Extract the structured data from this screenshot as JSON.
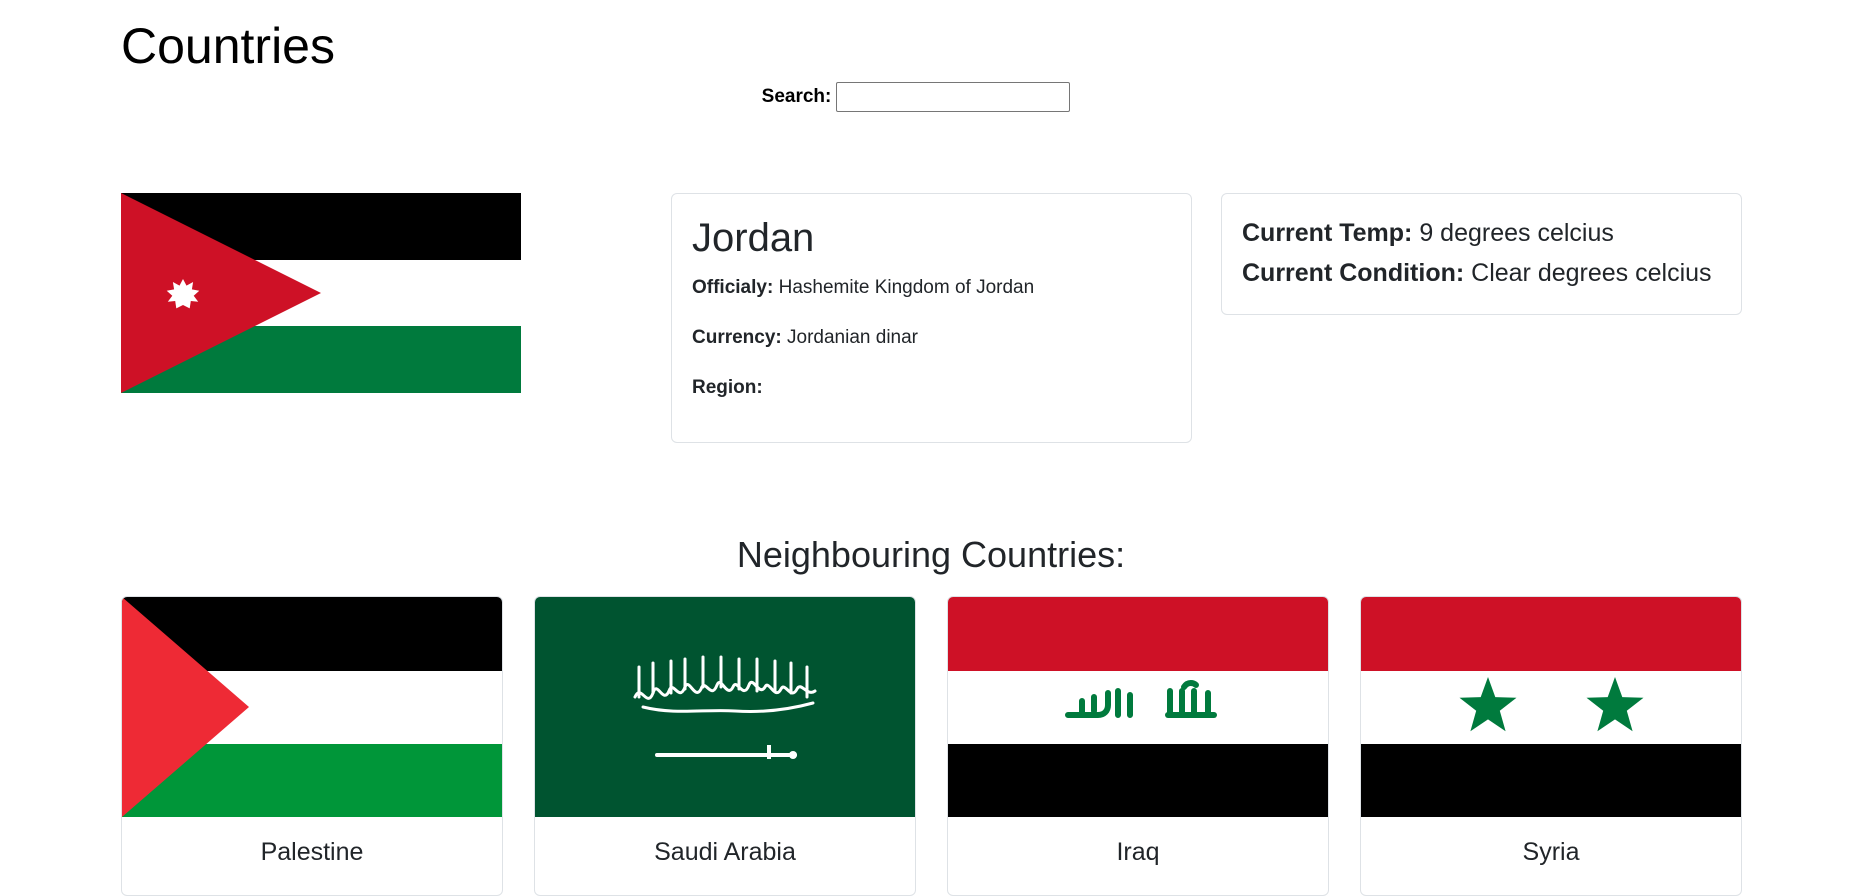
{
  "page": {
    "title": "Countries"
  },
  "search": {
    "label": "Search:",
    "value": "",
    "placeholder": ""
  },
  "country": {
    "name": "Jordan",
    "flag_icon": "jordan-flag",
    "official_label": "Officialy:",
    "official_value": "Hashemite Kingdom of Jordan",
    "currency_label": "Currency:",
    "currency_value": "Jordanian dinar",
    "region_label": "Region:",
    "region_value": ""
  },
  "weather": {
    "temp_label": "Current Temp:",
    "temp_value": "9 degrees celcius",
    "condition_label": "Current Condition:",
    "condition_value": "Clear degrees celcius"
  },
  "neighbours": {
    "heading": "Neighbouring Countries:",
    "items": [
      {
        "name": "Palestine",
        "flag_icon": "palestine-flag"
      },
      {
        "name": "Saudi Arabia",
        "flag_icon": "saudi-arabia-flag"
      },
      {
        "name": "Iraq",
        "flag_icon": "iraq-flag"
      },
      {
        "name": "Syria",
        "flag_icon": "syria-flag"
      }
    ]
  },
  "colors": {
    "black": "#000000",
    "white": "#ffffff",
    "jordan_red": "#ce1126",
    "jordan_green": "#007a3d",
    "palestine_red": "#ee2a35",
    "palestine_green": "#009639",
    "saudi_green": "#005430",
    "iraq_red": "#ce1126",
    "iraq_green": "#007a3d",
    "card_border": "#dee2e6"
  }
}
